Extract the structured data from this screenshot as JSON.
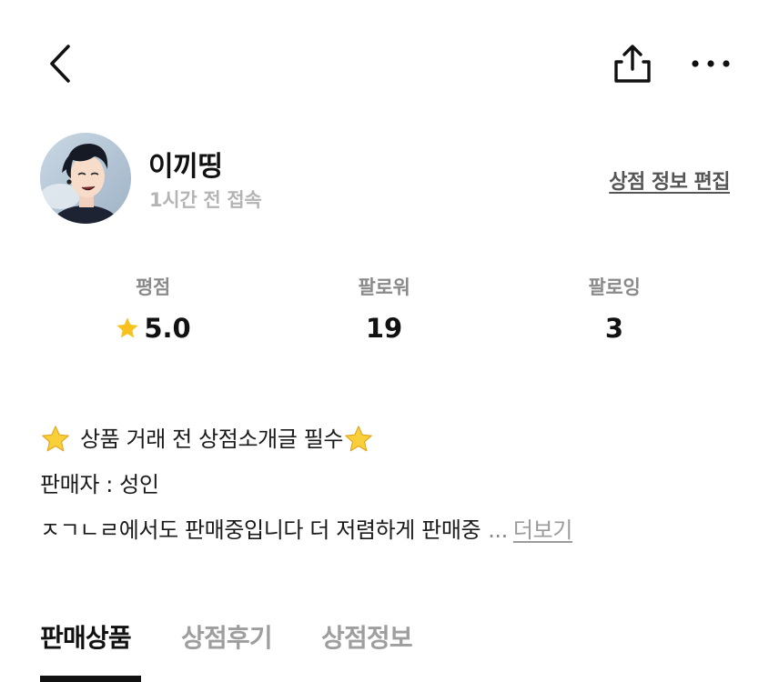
{
  "topbar": {
    "icons": [
      "back-icon",
      "share-icon",
      "more-icon"
    ]
  },
  "profile": {
    "shop_name": "이끼띵",
    "last_seen": "1시간 전 접속",
    "edit_label": "상점 정보 편집"
  },
  "stats": {
    "rating_label": "평점",
    "rating_value": "5.0",
    "followers_label": "팔로워",
    "followers_value": "19",
    "following_label": "팔로잉",
    "following_value": "3"
  },
  "intro": {
    "line1": "상품 거래 전 상점소개글 필수",
    "line2": "판매자 : 성인",
    "line3": "ㅈㄱㄴㄹ에서도 판매중입니다 더 저렴하게 판매중",
    "ellipsis": "...",
    "more_label": "더보기"
  },
  "tabs": {
    "products": "판매상품",
    "reviews": "상점후기",
    "info": "상점정보"
  },
  "colors": {
    "star": "#F7C21B",
    "muted": "#9e9e9e",
    "text": "#111111"
  }
}
